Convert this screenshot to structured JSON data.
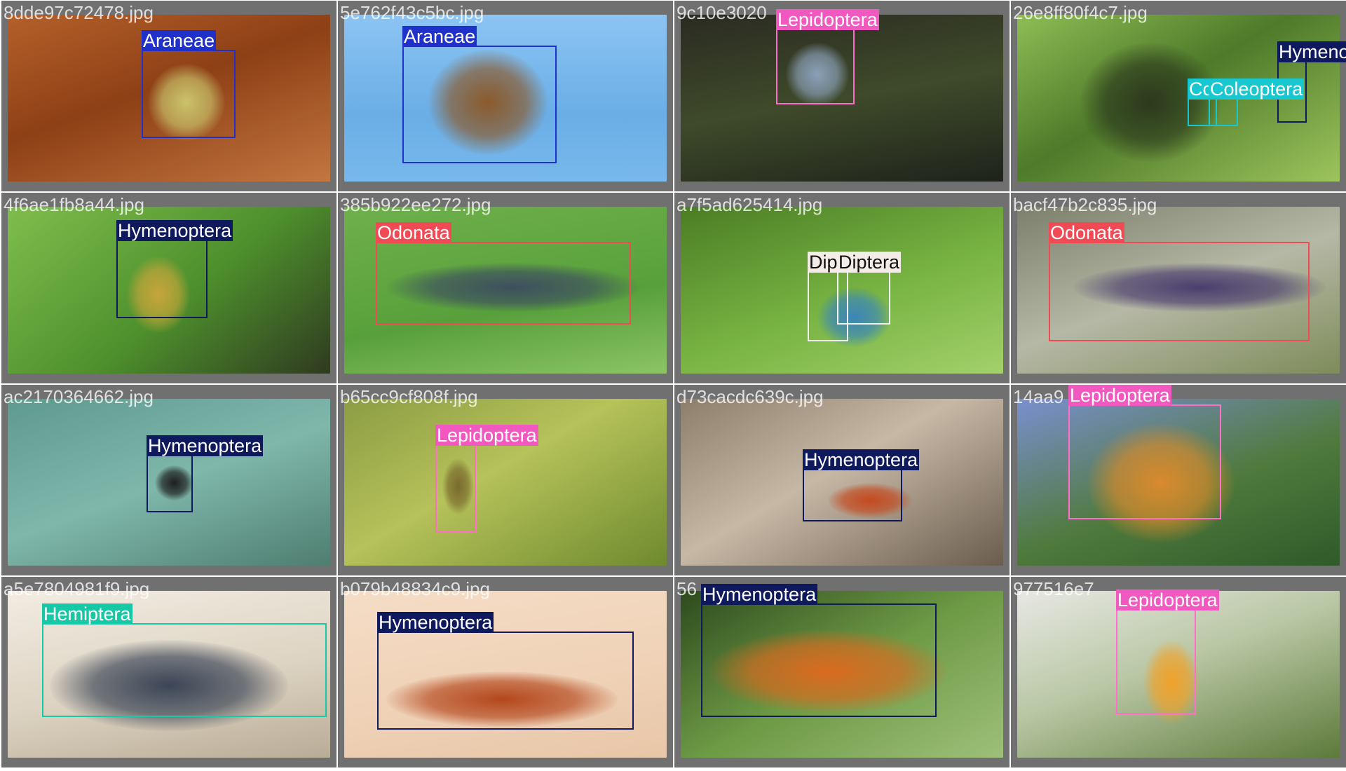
{
  "tiles": [
    {
      "filename": "8dde97c72478.jpg",
      "photo": "linear-gradient(160deg,#b5602a 0%,#8e4016 45%,#c37640 100%)",
      "subject": "#c9c36a",
      "detections": [
        {
          "label": "Araneae",
          "color": "#1f31c9",
          "labelColor": "#1f31c9",
          "dark": false
        }
      ]
    },
    {
      "filename": "5e762f43c5bc.jpg",
      "photo": "linear-gradient(180deg,#8cc4f3 0%,#6aaee6 60%,#78b8ec 100%)",
      "subject": "#8b5a2b",
      "detections": [
        {
          "label": "Araneae",
          "color": "#1f31c9",
          "labelColor": "#1f31c9",
          "dark": false
        }
      ]
    },
    {
      "filename": "9c10e3020",
      "photo": "linear-gradient(170deg,#2a2b22 0%,#3f4a2a 50%,#1e231b 100%)",
      "subject": "#8aa0b8",
      "detections": [
        {
          "label": "Lepidoptera",
          "color": "#ff6fc9",
          "labelColor": "#f259c0",
          "dark": false
        }
      ]
    },
    {
      "filename": "26e8ff80f4c7.jpg",
      "photo": "linear-gradient(150deg,#8fbd54 0%,#4e7a2a 45%,#9dc45c 100%)",
      "subject": "#2d3a1e",
      "detections": [
        {
          "label": "Hymenoptera",
          "color": "#0f1a5e",
          "labelColor": "#0f1a5e",
          "dark": false
        },
        {
          "label": "Cc",
          "color": "#18c7cf",
          "labelColor": "#18c7cf",
          "dark": false
        },
        {
          "label": "Coleoptera",
          "color": "#18c7cf",
          "labelColor": "#18c7cf",
          "dark": false
        }
      ]
    },
    {
      "filename": "4f6ae1fb8a44.jpg",
      "photo": "linear-gradient(140deg,#7fbe4d 0%,#4d8f2c 55%,#2f3a20 100%)",
      "subject": "#c6a53a",
      "detections": [
        {
          "label": "Hymenoptera",
          "color": "#0f1a5e",
          "labelColor": "#0f1a5e",
          "dark": false
        }
      ]
    },
    {
      "filename": "385b922ee272.jpg",
      "photo": "linear-gradient(170deg,#6fb04b 0%,#58a03b 60%,#8cc465 100%)",
      "subject": "#3d4f5e",
      "detections": [
        {
          "label": "Odonata",
          "color": "#f04b55",
          "labelColor": "#f04b55",
          "dark": false
        }
      ]
    },
    {
      "filename": "a7f5ad625414.jpg",
      "photo": "linear-gradient(160deg,#4b7d24 0%,#78b443 55%,#a3d06b 100%)",
      "subject": "#3a86b8",
      "detections": [
        {
          "label": "Dip",
          "color": "#f2f2f2",
          "labelColor": "#f4ece6",
          "dark": true
        },
        {
          "label": "Diptera",
          "color": "#f2f2f2",
          "labelColor": "#f4ece6",
          "dark": true
        }
      ]
    },
    {
      "filename": "bacf47b2c835.jpg",
      "photo": "linear-gradient(160deg,#7d7f6d 0%,#b6b8a6 50%,#7e8c5a 100%)",
      "subject": "#4b3e6e",
      "detections": [
        {
          "label": "Odonata",
          "color": "#f04b55",
          "labelColor": "#f04b55",
          "dark": false
        }
      ]
    },
    {
      "filename": "ac2170364662.jpg",
      "photo": "linear-gradient(160deg,#5f9a8f 0%,#7fb7ab 50%,#4e7e70 100%)",
      "subject": "#1e1e1e",
      "detections": [
        {
          "label": "Hymenoptera",
          "color": "#0f1a5e",
          "labelColor": "#0f1a5e",
          "dark": false
        }
      ]
    },
    {
      "filename": "b65cc9cf808f.jpg",
      "photo": "linear-gradient(150deg,#8b9c43 0%,#b6c25a 45%,#6e8a2e 100%)",
      "subject": "#7a6a2e",
      "detections": [
        {
          "label": "Lepidoptera",
          "color": "#ff6fc9",
          "labelColor": "#f259c0",
          "dark": false
        }
      ]
    },
    {
      "filename": "d73cacdc639c.jpg",
      "photo": "linear-gradient(150deg,#8d7e6c 0%,#c7b8a6 45%,#6b5d4e 100%)",
      "subject": "#c44a1f",
      "detections": [
        {
          "label": "Hymenoptera",
          "color": "#0f1a5e",
          "labelColor": "#0f1a5e",
          "dark": false
        }
      ]
    },
    {
      "filename": "14aa9",
      "photo": "linear-gradient(160deg,#7a8fd0 0%,#4f7a3c 55%,#2f5a2a 100%)",
      "subject": "#d98a2c",
      "detections": [
        {
          "label": "Lepidoptera",
          "color": "#ff6fc9",
          "labelColor": "#f259c0",
          "dark": false
        }
      ]
    },
    {
      "filename": "a5e7804981f9.jpg",
      "photo": "linear-gradient(170deg,#f2ece2 0%,#ddd3c2 55%,#b9ac97 100%)",
      "subject": "#3b4556",
      "detections": [
        {
          "label": "Hemiptera",
          "color": "#17c8a6",
          "labelColor": "#17c8a6",
          "dark": false
        }
      ]
    },
    {
      "filename": "b079b48834c9.jpg",
      "photo": "linear-gradient(170deg,#f5ddc6 0%,#efd1b6 60%,#e8c6a8 100%)",
      "subject": "#b4471c",
      "detections": [
        {
          "label": "Hymenoptera",
          "color": "#0f1a5e",
          "labelColor": "#0f1a5e",
          "dark": false
        }
      ]
    },
    {
      "filename": "56",
      "photo": "linear-gradient(150deg,#2d4a1e 0%,#6d9a45 50%,#9ec07a 100%)",
      "subject": "#d96a1f",
      "detections": [
        {
          "label": "Hymenoptera",
          "color": "#0f1a5e",
          "labelColor": "#0f1a5e",
          "dark": false
        }
      ]
    },
    {
      "filename": "977516e7",
      "photo": "linear-gradient(160deg,#e8e8e4 0%,#b9c7a4 45%,#5d7a3a 100%)",
      "subject": "#f0a22a",
      "detections": [
        {
          "label": "Lepidoptera",
          "color": "#ff6fc9",
          "labelColor": "#f259c0",
          "dark": false
        }
      ]
    }
  ]
}
